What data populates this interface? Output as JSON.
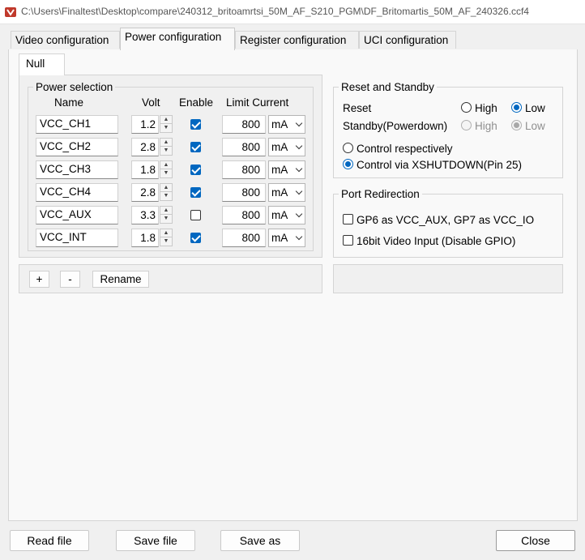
{
  "window": {
    "title": "C:\\Users\\Finaltest\\Desktop\\compare\\240312_britoamrtsi_50M_AF_S210_PGM\\DF_Britomartis_50M_AF_240326.ccf4"
  },
  "tabs": [
    {
      "label": "Video configuration"
    },
    {
      "label": "Power configuration"
    },
    {
      "label": "Register configuration"
    },
    {
      "label": "UCI configuration"
    }
  ],
  "subtab": {
    "label": "Null"
  },
  "power": {
    "legend": "Power selection",
    "headers": {
      "name": "Name",
      "volt": "Volt",
      "enable": "Enable",
      "limit": "Limit Current"
    },
    "rows": [
      {
        "name": "VCC_CH1",
        "volt": "1.2",
        "enabled": true,
        "limit": "800",
        "unit": "mA"
      },
      {
        "name": "VCC_CH2",
        "volt": "2.8",
        "enabled": true,
        "limit": "800",
        "unit": "mA"
      },
      {
        "name": "VCC_CH3",
        "volt": "1.8",
        "enabled": true,
        "limit": "800",
        "unit": "mA"
      },
      {
        "name": "VCC_CH4",
        "volt": "2.8",
        "enabled": true,
        "limit": "800",
        "unit": "mA"
      },
      {
        "name": "VCC_AUX",
        "volt": "3.3",
        "enabled": false,
        "limit": "800",
        "unit": "mA"
      },
      {
        "name": "VCC_INT",
        "volt": "1.8",
        "enabled": true,
        "limit": "800",
        "unit": "mA"
      }
    ],
    "buttons": {
      "add": "+",
      "remove": "-",
      "rename": "Rename"
    }
  },
  "reset": {
    "legend": "Reset and Standby",
    "reset_label": "Reset",
    "standby_label": "Standby(Powerdown)",
    "high": "High",
    "low": "Low",
    "reset_selected": "Low",
    "standby_selected": "Low",
    "control_respectively": "Control respectively",
    "control_xshutdown": "Control via XSHUTDOWN(Pin 25)",
    "control_selected": "xshutdown"
  },
  "port": {
    "legend": "Port Redirection",
    "gp6": "GP6 as VCC_AUX, GP7 as VCC_IO",
    "video16": "16bit Video Input (Disable GPIO)",
    "gp6_checked": false,
    "video16_checked": false
  },
  "footer": {
    "read": "Read file",
    "save": "Save file",
    "saveas": "Save as",
    "close": "Close"
  }
}
